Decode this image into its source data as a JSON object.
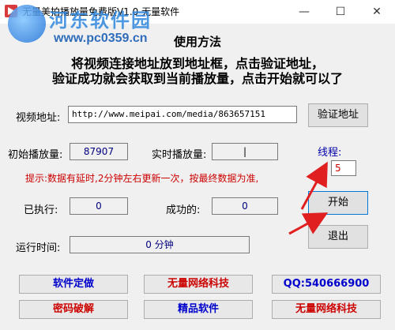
{
  "window": {
    "title": "无量美拍播放量免费版V1.0      无量软件",
    "minimize": "—",
    "maximize": "☐",
    "close": "✕"
  },
  "watermark": {
    "name": "河东软件园",
    "url": "www.pc0359.cn"
  },
  "usage": {
    "title": "使用方法",
    "line1": "将视频连接地址放到地址框，点击验证地址，",
    "line2": "验证成功就会获取到当前播放量，点击开始就可以了"
  },
  "video": {
    "label": "视频地址:",
    "url": "http://www.meipai.com/media/863657151",
    "verify_button": "验证地址"
  },
  "plays": {
    "initial_label": "初始播放量:",
    "initial_value": "87907",
    "realtime_label": "实时播放量:",
    "realtime_value": "|"
  },
  "threads": {
    "label": "线程:",
    "value": "5"
  },
  "hint": "提示:数据有延时,2分钟左右更新一次，按最终数据为准,",
  "stats": {
    "executed_label": "已执行:",
    "executed_value": "0",
    "success_label": "成功的:",
    "success_value": "0"
  },
  "controls": {
    "start_button": "开始",
    "exit_button": "退出"
  },
  "runtime": {
    "label": "运行时间:",
    "value": "0 分钟"
  },
  "links": {
    "custom": "软件定做",
    "company1": "无量网络科技",
    "qq": "QQ:540666900",
    "crack": "密码破解",
    "quality": "精品软件",
    "company2": "无量网络科技"
  },
  "colors": {
    "arrow": "#e02020",
    "field_text": "#00007f",
    "hint": "#cc0000"
  }
}
